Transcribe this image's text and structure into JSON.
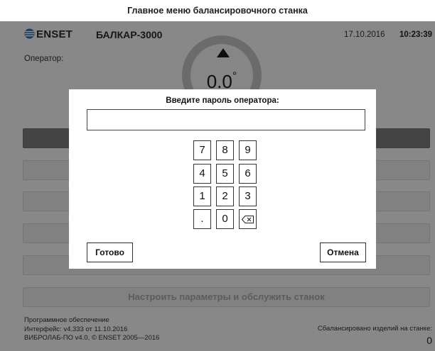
{
  "window": {
    "title": "Главное меню балансировочного станка"
  },
  "header": {
    "brand": "ENSET",
    "model": "БАЛКАР-3000",
    "date": "17.10.2016",
    "time": "10:23:39",
    "operator_label": "Оператор:"
  },
  "gauge": {
    "value": "0.0",
    "unit": "°"
  },
  "menu": {
    "last_button_label": "Настроить параметры и обслужить станок"
  },
  "footer": {
    "software_label": "Программное обеспечение",
    "interface_version": "Интерфейс: v4.333 от 11.10.2016",
    "core_version": "ВИБРОЛАБ-ПО v4.0, © ENSET 2005—2016",
    "balanced_label": "Сбалансировано изделий на станке:",
    "balanced_count": "0"
  },
  "dialog": {
    "title": "Введите пароль оператора:",
    "password_value": "",
    "keypad": {
      "keys": [
        "7",
        "8",
        "9",
        "4",
        "5",
        "6",
        "1",
        "2",
        "3",
        ".",
        "0"
      ],
      "backspace_icon": "backspace-icon"
    },
    "ok_label": "Готово",
    "cancel_label": "Отмена"
  },
  "colors": {
    "overlay": "#000000",
    "gauge_ring": "#c3c3c3",
    "dialog_bg": "#ffffff"
  }
}
